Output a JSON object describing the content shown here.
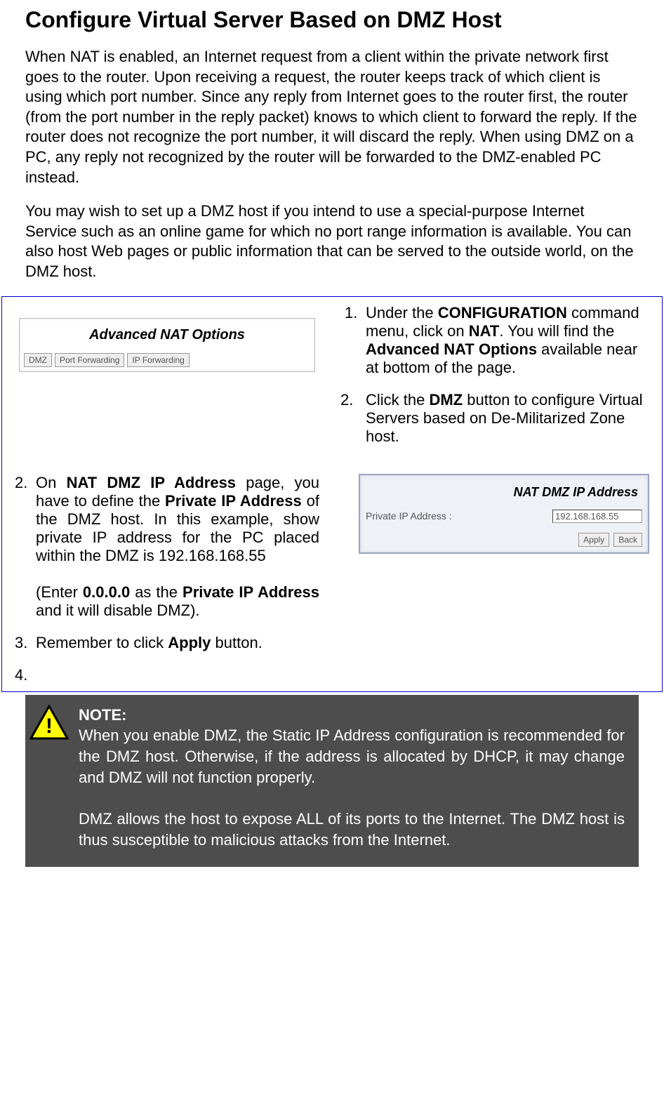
{
  "title": "Configure Virtual Server Based on DMZ Host",
  "intro_p1": "When NAT is enabled, an Internet request from a client within the private network first goes to the router. Upon receiving a request, the router keeps track of which client is using which port number. Since any reply from Internet goes to the router first, the router (from the port number in the reply packet) knows to which client to forward the reply. If the router does not recognize the port number, it will discard the reply. When using DMZ on a PC, any reply not recognized by the router will be forwarded to the DMZ-enabled PC instead.",
  "intro_p2": "You may wish to set up a DMZ host if you intend to use a special-purpose Internet Service such as an online game for which no port range information is available. You can also host Web pages or public information that can be served to the outside world, on the DMZ host.",
  "adv_nat": {
    "title": "Advanced NAT Options",
    "btn_dmz": "DMZ",
    "btn_pf": "Port Forwarding",
    "btn_ipf": "IP Forwarding"
  },
  "right1_num": "1.",
  "right1_a": "Under the ",
  "right1_b": "CONFIGURATION",
  "right1_c": " command menu, click on ",
  "right1_d": "NAT",
  "right1_e": ". You will find the ",
  "right1_f": "Advanced NAT Options",
  "right1_g": " available near at bottom of the page.",
  "right2_num": "2.",
  "right2_a": "Click the ",
  "right2_b": "DMZ",
  "right2_c": " button to configure Virtual Servers based on De-Militarized Zone host.",
  "left2_num": "2.",
  "left2_a": "On ",
  "left2_b": "NAT DMZ IP Address",
  "left2_c": " page, you have to define the ",
  "left2_d": "Private IP Address",
  "left2_e": " of the DMZ host. In this example, show private IP address for the PC placed within the DMZ is 192.168.168.55",
  "left2_sub_a": "(Enter ",
  "left2_sub_b": "0.0.0.0",
  "left2_sub_c": " as the ",
  "left2_sub_d": "Private IP Address",
  "left2_sub_e": " and it will disable DMZ).",
  "left3_num": "3.",
  "left3_a": "Remember to click ",
  "left3_b": "Apply",
  "left3_c": " button.",
  "left4_num": "4.",
  "dmz_panel": {
    "title": "NAT DMZ IP Address",
    "label": "Private IP Address :",
    "value": "192.168.168.55",
    "btn_apply": "Apply",
    "btn_back": "Back"
  },
  "note": {
    "title": "NOTE:",
    "p1": "When you enable DMZ, the Static IP Address configuration is recommended for the DMZ host. Otherwise, if the address is allocated by DHCP, it may change and DMZ will not function properly.",
    "p2": "DMZ allows the host to expose ALL of its ports to the Internet. The DMZ host is thus susceptible to malicious attacks from the Internet."
  }
}
